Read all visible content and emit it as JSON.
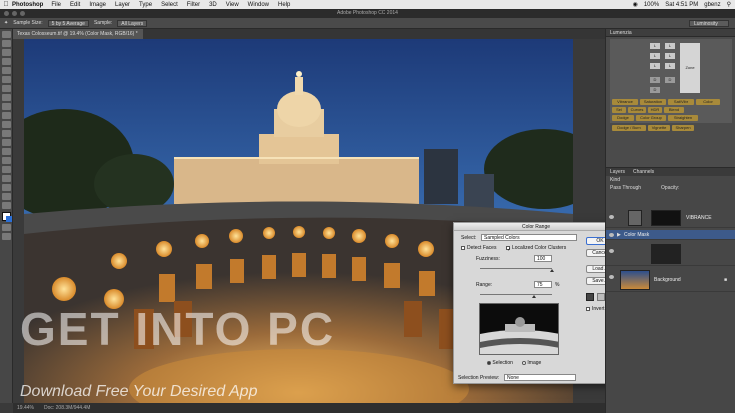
{
  "menubar": {
    "app": "Photoshop",
    "items": [
      "File",
      "Edit",
      "Image",
      "Layer",
      "Type",
      "Select",
      "Filter",
      "3D",
      "View",
      "Window",
      "Help"
    ],
    "battery": "100%",
    "time": "Sat 4:51 PM",
    "user": "gbenz"
  },
  "window": {
    "title": "Adobe Photoshop CC 2014"
  },
  "options_bar": {
    "sample_size_label": "Sample Size:",
    "sample_size_value": "5 by 5 Average",
    "sample_label": "Sample:",
    "sample_value": "All Layers",
    "workspace": "Luminosity"
  },
  "document": {
    "tab": "Texas Colosseum.tif @ 19.4% (Color Mask, RGB/16) *"
  },
  "statusbar": {
    "zoom": "19.44%",
    "doc_size": "Doc: 208.3M/944.4M"
  },
  "lumenzia": {
    "title": "Lumenzia",
    "cells": [
      "L",
      "L",
      "L",
      "L",
      "L",
      "L",
      "D",
      "D",
      "D",
      "Zone"
    ],
    "buttons": [
      "Vibrance",
      "Saturation",
      "Sat/Vibr",
      "Color",
      "Sel",
      "Curves",
      "HDR",
      "Blend",
      "Dodge",
      "Color Group",
      "Straighten",
      "Dodge / Burn",
      "Vignette",
      "Sharpen"
    ]
  },
  "layers": {
    "tabs": [
      "Layers",
      "Channels"
    ],
    "kind": "Kind",
    "blend_mode": "Pass Through",
    "opacity_label": "Opacity:",
    "rows": [
      {
        "name": "VIBRANCE"
      },
      {
        "name": "Color Mask"
      },
      {
        "name": ""
      },
      {
        "name": "Background"
      }
    ]
  },
  "color_range": {
    "title": "Color Range",
    "select_label": "Select:",
    "select_value": "Sampled Colors",
    "detect_faces": "Detect Faces",
    "localized": "Localized Color Clusters",
    "fuzziness_label": "Fuzziness:",
    "fuzziness_value": "100",
    "range_label": "Range:",
    "range_value": "75",
    "range_unit": "%",
    "selection_radio": "Selection",
    "image_radio": "Image",
    "preview_label": "Selection Preview:",
    "preview_value": "None",
    "buttons": {
      "ok": "OK",
      "cancel": "Cancel",
      "load": "Load...",
      "save": "Save..."
    },
    "invert": "Invert"
  },
  "watermark": {
    "main": "GET INTO PC",
    "sub": "Download Free Your Desired App"
  }
}
